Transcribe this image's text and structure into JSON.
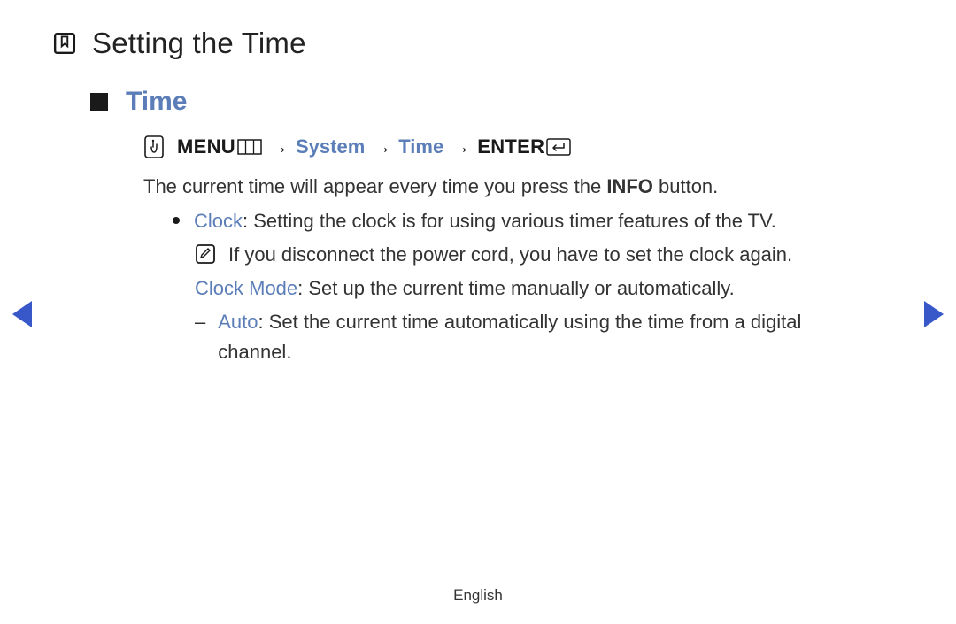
{
  "page": {
    "title": "Setting the Time",
    "section_title": "Time",
    "footer_language": "English"
  },
  "breadcrumb": {
    "menu_label": "MENU",
    "arrow": "→",
    "system_label": "System",
    "time_label": "Time",
    "enter_label": "ENTER"
  },
  "body": {
    "intro_prefix": "The current time will appear every time you press the ",
    "intro_bold": "INFO",
    "intro_suffix": " button."
  },
  "clock": {
    "term": "Clock",
    "text": ": Setting the clock is for using various timer features of the TV.",
    "note_text": "If you disconnect the power cord, you have to set the clock again."
  },
  "clock_mode": {
    "term": "Clock Mode",
    "text": ": Set up the current time manually or automatically."
  },
  "auto": {
    "dash": "–",
    "term": "Auto",
    "text": ": Set the current time automatically using the time from a digital channel."
  }
}
